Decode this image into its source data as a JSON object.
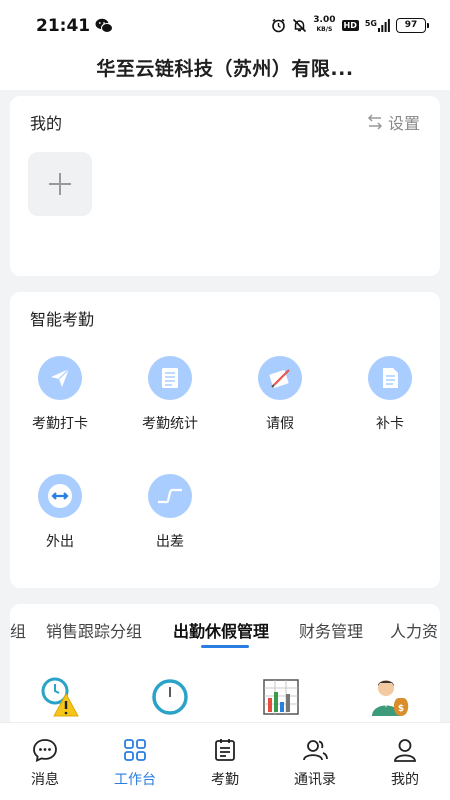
{
  "status_bar": {
    "time": "21:41",
    "speed_value": "3.00",
    "speed_unit": "KB/S",
    "hd_label": "HD",
    "network_label": "5G",
    "battery": "97"
  },
  "header": {
    "title": "华至云链科技（苏州）有限..."
  },
  "mine_section": {
    "title": "我的",
    "settings_label": "设置"
  },
  "attendance_section": {
    "title": "智能考勤",
    "items": [
      {
        "label": "考勤打卡",
        "icon": "paper-plane-icon"
      },
      {
        "label": "考勤统计",
        "icon": "document-list-icon"
      },
      {
        "label": "请假",
        "icon": "pen-note-icon"
      },
      {
        "label": "补卡",
        "icon": "document-icon"
      },
      {
        "label": "外出",
        "icon": "arrows-left-right-icon"
      },
      {
        "label": "出差",
        "icon": "step-curve-icon"
      }
    ]
  },
  "tabs_section": {
    "tabs": [
      {
        "label": "组"
      },
      {
        "label": "销售跟踪分组"
      },
      {
        "label": "出勤休假管理",
        "active": true
      },
      {
        "label": "财务管理"
      },
      {
        "label": "人力资"
      }
    ],
    "apps": [
      {
        "icon": "clock-warning-icon"
      },
      {
        "icon": "clock-icon"
      },
      {
        "icon": "bar-chart-table-icon"
      },
      {
        "icon": "person-money-icon"
      }
    ]
  },
  "bottom_nav": {
    "items": [
      {
        "label": "消息",
        "icon": "chat-bubble-icon"
      },
      {
        "label": "工作台",
        "icon": "grid-icon",
        "active": true
      },
      {
        "label": "考勤",
        "icon": "calendar-note-icon"
      },
      {
        "label": "通讯录",
        "icon": "contacts-icon"
      },
      {
        "label": "我的",
        "icon": "person-icon"
      }
    ]
  },
  "colors": {
    "accent": "#2a7de1",
    "icon_bg": "#aacdff",
    "page_bg": "#f2f3f5"
  }
}
